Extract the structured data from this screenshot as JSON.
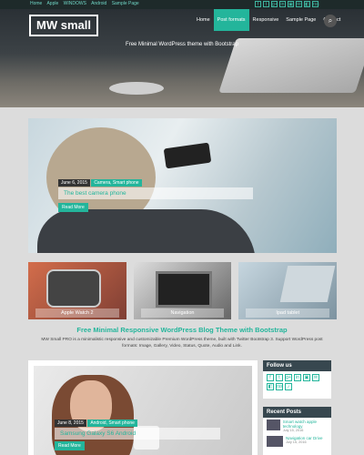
{
  "top_nav": [
    "Home",
    "Apple",
    "WINDOWS",
    "Android",
    "Sample Page"
  ],
  "social_icons": [
    "f",
    "t",
    "g+",
    "in",
    "▣",
    "✉",
    "◧",
    "rss"
  ],
  "site": {
    "logo": "MW small",
    "tagline": "Free Minimal WordPress theme with Bootstrap"
  },
  "main_nav": [
    {
      "label": "Home",
      "active": false
    },
    {
      "label": "Post formats",
      "active": true
    },
    {
      "label": "Responsive",
      "active": false
    },
    {
      "label": "Sample Page",
      "active": false
    },
    {
      "label": "Contact",
      "active": false
    }
  ],
  "featured": {
    "date": "June 6, 2015",
    "categories": "Camera, Smart phone",
    "title": "The best camera phone",
    "read_more": "Read More"
  },
  "tiles": [
    {
      "caption": "Apple Watch 2"
    },
    {
      "caption": "Navigation"
    },
    {
      "caption": "Ipad tablet"
    }
  ],
  "section": {
    "title": "Free Minimal Responsive WordPress Blog Theme with Bootstrap",
    "text": "MW Small PRO is a minimalistic responsive and customizable Premium WordPress theme, built with Twitter Bootstrap 3. Support WordPress post formats: Image, Gallery, Video, Status, Quote, Audio and Link."
  },
  "post2": {
    "date": "June 8, 2015",
    "categories": "Android, Smart phone",
    "title": "Samsung Galaxy S6 Android",
    "read_more": "Read More"
  },
  "sidebar": {
    "follow_title": "Follow us",
    "follow_icons": [
      "f",
      "t",
      "g+",
      "in",
      "▣",
      "✉",
      "◧",
      "rss",
      "♪"
    ],
    "recent_title": "Recent Posts",
    "recent": [
      {
        "title": "Smart watch apple technology",
        "date": "July 15, 2016"
      },
      {
        "title": "Navigation car Drive",
        "date": "July 15, 2016"
      }
    ]
  }
}
